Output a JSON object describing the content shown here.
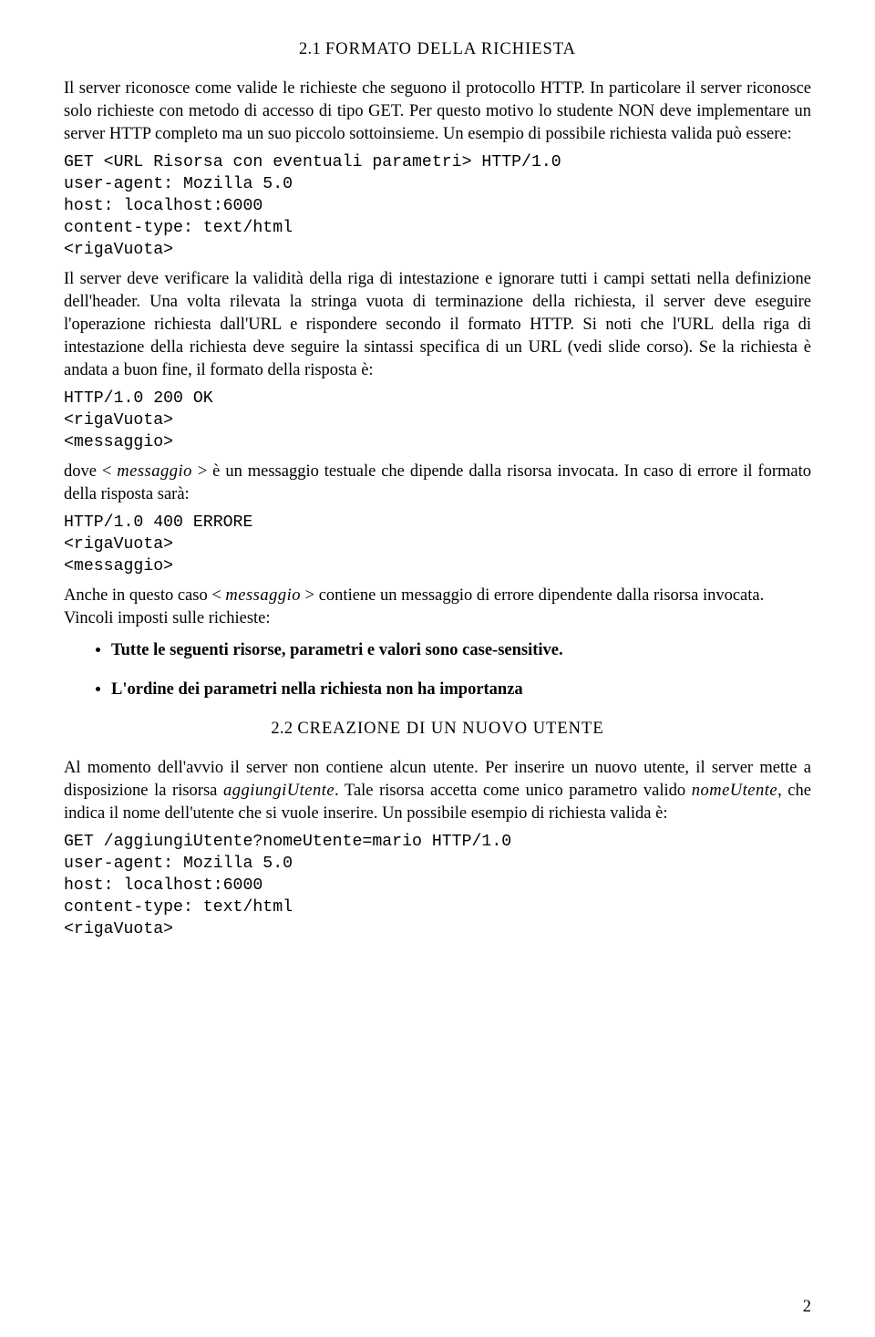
{
  "section1": {
    "number": "2.1",
    "title": "FORMATO DELLA RICHIESTA"
  },
  "p1": "Il server riconosce come valide le richieste che seguono il protocollo HTTP. In particolare il server riconosce solo richieste con metodo di accesso di tipo GET. Per questo motivo lo studente NON deve implementare un server HTTP completo ma un suo piccolo sottoinsieme. Un esempio di possibile richiesta valida può essere:",
  "code1": "GET <URL Risorsa con eventuali parametri> HTTP/1.0\nuser-agent: Mozilla 5.0\nhost: localhost:6000\ncontent-type: text/html\n<rigaVuota>",
  "p2": "Il server deve verificare la validità della riga di intestazione e ignorare tutti i campi settati nella definizione dell'header. Una volta rilevata la stringa vuota di terminazione della richiesta, il server deve eseguire l'operazione richiesta dall'URL e rispondere secondo il formato HTTP. Si noti che l'URL della riga di intestazione della richiesta deve seguire la sintassi specifica di un URL (vedi slide corso). Se la richiesta è andata a buon fine, il formato della risposta è:",
  "code2": "HTTP/1.0 200 OK\n<rigaVuota>\n<messaggio>",
  "p3a": "dove < ",
  "p3b": "messaggio",
  "p3c": " > è un messaggio testuale che dipende dalla risorsa invocata. In caso di errore il formato della risposta sarà:",
  "code3": "HTTP/1.0 400 ERRORE\n<rigaVuota>\n<messaggio>",
  "p4a": "Anche in questo caso < ",
  "p4b": "messaggio",
  "p4c": " > contiene un messaggio di errore dipendente dalla risorsa invocata.",
  "p5": "Vincoli imposti sulle richieste:",
  "bullets": {
    "b1": "Tutte le seguenti risorse, parametri e valori sono case-sensitive.",
    "b2": "L'ordine dei parametri nella richiesta non ha importanza"
  },
  "section2": {
    "number": "2.2",
    "title": "CREAZIONE DI UN NUOVO UTENTE"
  },
  "p6a": "Al momento dell'avvio il server non contiene alcun utente. Per inserire un nuovo utente, il server mette a disposizione la risorsa ",
  "p6b": "aggiungiUtente",
  "p6c": ". Tale risorsa accetta come unico parametro valido ",
  "p6d": "nomeUtente",
  "p6e": ", che indica il nome dell'utente che si vuole inserire. Un possibile esempio di richiesta valida è:",
  "code4": "GET /aggiungiUtente?nomeUtente=mario HTTP/1.0\nuser-agent: Mozilla 5.0\nhost: localhost:6000\ncontent-type: text/html\n<rigaVuota>",
  "pagenum": "2"
}
